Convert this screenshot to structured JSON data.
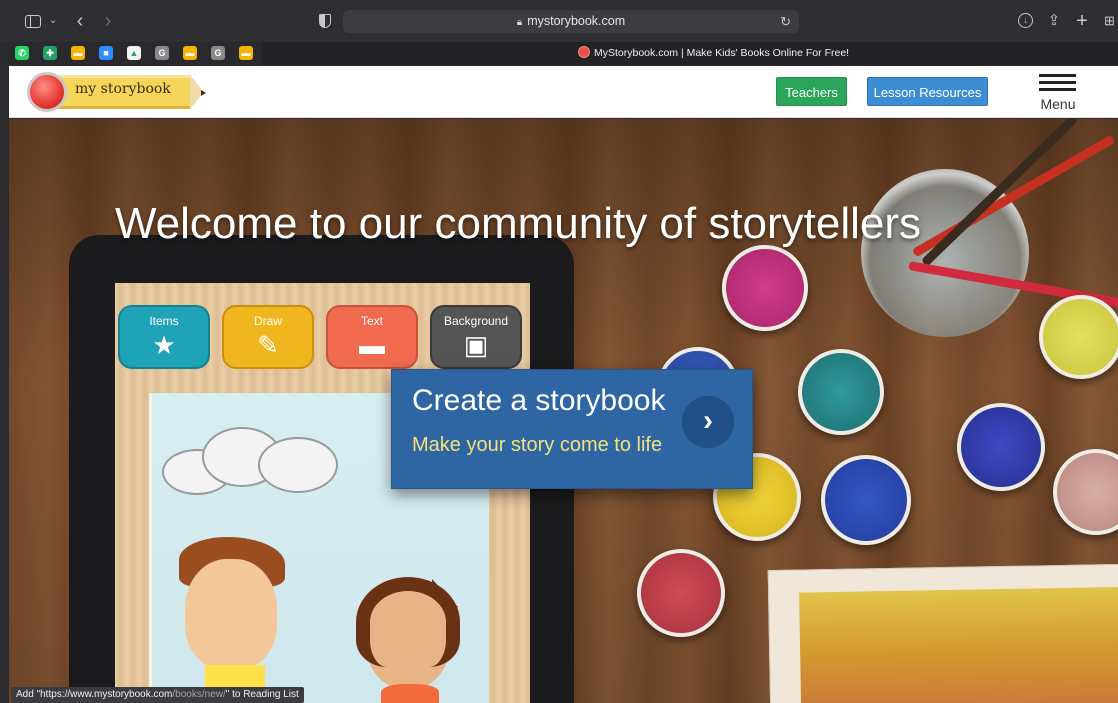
{
  "browser": {
    "url": "mystorybook.com",
    "tab_title": "MyStorybook.com | Make Kids' Books Online For Free!",
    "pinned_tabs": [
      {
        "icon": "whatsapp-icon",
        "color": "#25d366",
        "glyph": "✆"
      },
      {
        "icon": "google-sheets-icon",
        "color": "#1fa463",
        "glyph": "✚"
      },
      {
        "icon": "google-slides-icon",
        "color": "#f4b400",
        "glyph": "▬"
      },
      {
        "icon": "zoom-icon",
        "color": "#2d8cff",
        "glyph": "■"
      },
      {
        "icon": "google-drive-icon",
        "color": "#f2f2f2",
        "glyph": "▲"
      },
      {
        "icon": "grammarly-icon",
        "color": "#8a8a8a",
        "glyph": "G"
      },
      {
        "icon": "google-slides-icon-2",
        "color": "#f4b400",
        "glyph": "▬"
      },
      {
        "icon": "grammarly-icon-2",
        "color": "#8a8a8a",
        "glyph": "G"
      },
      {
        "icon": "google-slides-icon-3",
        "color": "#f4b400",
        "glyph": "▬"
      }
    ],
    "status_prefix": "Add \"https://www.mystorybook.com",
    "status_path": "/books/new/",
    "status_suffix": "\" to Reading List"
  },
  "header": {
    "logo_text": "my storybook",
    "teachers_label": "Teachers",
    "lesson_label": "Lesson Resources",
    "menu_label": "Menu"
  },
  "hero": {
    "title": "Welcome to our community of storytellers",
    "cta_title": "Create a storybook",
    "cta_subtitle": "Make your story come to life",
    "tools": {
      "items": "Items",
      "draw": "Draw",
      "text": "Text",
      "background": "Background"
    }
  }
}
